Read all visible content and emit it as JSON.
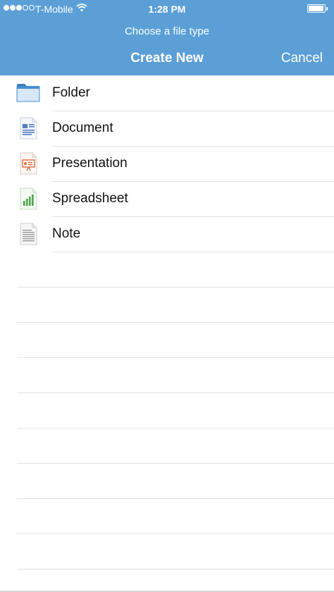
{
  "status_bar": {
    "carrier": "T-Mobile",
    "time": "1:28 PM",
    "signal_strength_of_5": 3,
    "wifi_icon": "wifi-icon",
    "battery_icon": "battery-icon",
    "battery_level_fraction": 0.95
  },
  "header": {
    "subtitle": "Choose a file type",
    "title": "Create New",
    "cancel_label": "Cancel",
    "background_color": "#5b9fd6"
  },
  "file_types": [
    {
      "label": "Folder",
      "icon": "folder-icon",
      "color": "#4a8fd0"
    },
    {
      "label": "Document",
      "icon": "document-icon",
      "color": "#4e7fc1"
    },
    {
      "label": "Presentation",
      "icon": "presentation-icon",
      "color": "#e26b3a"
    },
    {
      "label": "Spreadsheet",
      "icon": "spreadsheet-icon",
      "color": "#4aa64a"
    },
    {
      "label": "Note",
      "icon": "note-icon",
      "color": "#9a9a9a"
    }
  ]
}
